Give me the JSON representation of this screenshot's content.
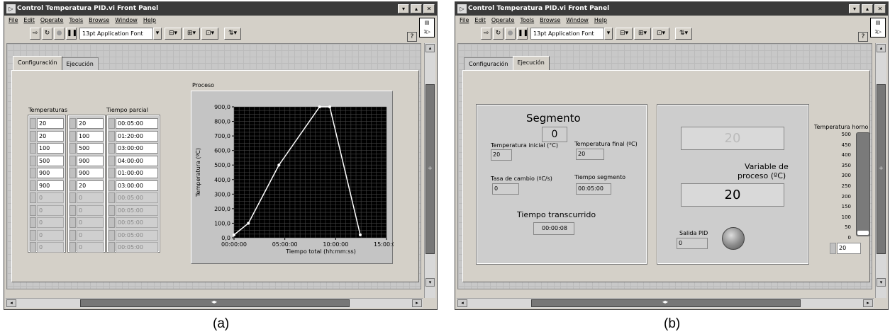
{
  "window_a": {
    "title": "Control Temperatura PID.vi Front Panel",
    "menu": [
      "File",
      "Edit",
      "Operate",
      "Tools",
      "Browse",
      "Window",
      "Help"
    ],
    "font_name": "13pt Application Font",
    "tabs": [
      "Configuración",
      "Ejecución"
    ],
    "active_tab": 0,
    "col_labels": {
      "temperaturas": "Temperaturas",
      "tiempo": "Tiempo parcial"
    },
    "idx_values": [
      "0",
      "0",
      "0"
    ],
    "temp_start": [
      "20",
      "20",
      "100",
      "500",
      "900",
      "900",
      "0",
      "0",
      "0",
      "0",
      "0"
    ],
    "temp_end": [
      "20",
      "100",
      "500",
      "900",
      "900",
      "20",
      "0",
      "0",
      "0",
      "0",
      "0"
    ],
    "tiempo": [
      "00:05:00",
      "01:20:00",
      "03:00:00",
      "04:00:00",
      "01:00:00",
      "03:00:00",
      "00:05:00",
      "00:05:00",
      "00:05:00",
      "00:05:00",
      "00:05:00"
    ],
    "graph_title": "Proceso"
  },
  "chart_data": {
    "type": "line",
    "title": "Proceso",
    "xlabel": "Tiempo total (hh:mm:ss)",
    "ylabel": "Temperatura (ºC)",
    "x_ticks": [
      "00:00:00",
      "05:00:00",
      "10:00:00",
      "15:00:00"
    ],
    "y_ticks": [
      "0,0",
      "100,0",
      "200,0",
      "300,0",
      "400,0",
      "500,0",
      "600,0",
      "700,0",
      "800,0",
      "900,0"
    ],
    "xlim_hours": [
      0,
      15
    ],
    "ylim": [
      0,
      900
    ],
    "grid": true,
    "series": [
      {
        "x_hours": [
          0,
          1.4167,
          4.4167,
          8.4167,
          9.4167,
          12.4167
        ],
        "y": [
          20,
          100,
          500,
          900,
          900,
          20
        ]
      }
    ]
  },
  "window_b": {
    "title": "Control Temperatura PID.vi Front Panel",
    "menu": [
      "File",
      "Edit",
      "Operate",
      "Tools",
      "Browse",
      "Window",
      "Help"
    ],
    "font_name": "13pt Application Font",
    "tabs": [
      "Configuración",
      "Ejecución"
    ],
    "active_tab": 1,
    "segmento_label": "Segmento",
    "segmento_value": "0",
    "temp_inicial_label": "Temperatura inicial (°C)",
    "temp_inicial_value": "20",
    "temp_final_label": "Temperatura final (ºC)",
    "temp_final_value": "20",
    "tasa_label": "Tasa de cambio (ºC/s)",
    "tasa_value": "0",
    "tiempo_seg_label": "Tiempo segmento",
    "tiempo_seg_value": "00:05:00",
    "transcurrido_label": "Tiempo transcurrido",
    "transcurrido_value": "00:00:08",
    "setpoint_value": "20",
    "variable_label_1": "Variable de",
    "variable_label_2": "proceso (ºC)",
    "variable_value": "20",
    "salida_label": "Salida PID",
    "salida_value": "0",
    "horno_label": "Temperatura horno",
    "horno_ticks": [
      "500",
      "450",
      "400",
      "350",
      "300",
      "250",
      "200",
      "150",
      "100",
      "50",
      "0"
    ],
    "horno_value": "20",
    "horno_level": 20
  },
  "captions": {
    "a": "(a)",
    "b": "(b)"
  },
  "colors": {
    "titlebar": "#3a3a3a",
    "graph_bg": "#000000",
    "plot_line": "#ffffff",
    "led": "#8a8a8a"
  }
}
